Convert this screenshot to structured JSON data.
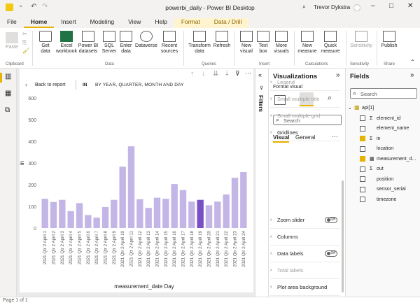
{
  "window": {
    "title": "powerbi_daily - Power BI Desktop",
    "user": "Trevor Dykstra"
  },
  "menu": {
    "items": [
      "File",
      "Home",
      "Insert",
      "Modeling",
      "View",
      "Help",
      "Format",
      "Data / Drill"
    ],
    "active": "Home",
    "contextual": [
      "Format",
      "Data / Drill"
    ]
  },
  "ribbon": {
    "clipboard": {
      "paste": "Paste",
      "group": "Clipboard"
    },
    "data": {
      "buttons": [
        "Get data",
        "Excel workbook",
        "Power BI datasets",
        "SQL Server",
        "Enter data",
        "Dataverse",
        "Recent sources"
      ],
      "group": "Data"
    },
    "queries": {
      "buttons": [
        "Transform data",
        "Refresh"
      ],
      "group": "Queries"
    },
    "insert": {
      "buttons": [
        "New visual",
        "Text box",
        "More visuals"
      ],
      "group": "Insert"
    },
    "calculations": {
      "buttons": [
        "New measure",
        "Quick measure"
      ],
      "group": "Calculations"
    },
    "sensitivity": {
      "buttons": [
        "Sensitivity"
      ],
      "group": "Sensitivity"
    },
    "share": {
      "buttons": [
        "Publish"
      ],
      "group": "Share"
    }
  },
  "visual_header": {
    "back": "Back to report",
    "field": "IN",
    "drill": "BY YEAR, QUARTER, MONTH AND DAY"
  },
  "chart_data": {
    "type": "bar",
    "categories": [
      "2021 Qtr 2 April 1",
      "2021 Qtr 2 April 2",
      "2021 Qtr 2 April 3",
      "2021 Qtr 2 April 4",
      "2021 Qtr 2 April 5",
      "2021 Qtr 2 April 6",
      "2021 Qtr 2 April 7",
      "2021 Qtr 2 April 8",
      "2021 Qtr 2 April 9",
      "2021 Qtr 2 April 10",
      "2021 Qtr 2 April 11",
      "2021 Qtr 2 April 12",
      "2021 Qtr 2 April 13",
      "2021 Qtr 2 April 14",
      "2021 Qtr 2 April 15",
      "2021 Qtr 2 April 16",
      "2021 Qtr 2 April 17",
      "2021 Qtr 2 April 18",
      "2021 Qtr 2 April 19",
      "2021 Qtr 2 April 20",
      "2021 Qtr 2 April 21",
      "2021 Qtr 2 April 22",
      "2021 Qtr 2 April 23",
      "2021 Qtr 2 April 24"
    ],
    "values": [
      135,
      120,
      130,
      78,
      115,
      60,
      48,
      97,
      130,
      283,
      377,
      133,
      93,
      140,
      135,
      203,
      175,
      122,
      130,
      105,
      122,
      155,
      232,
      258
    ],
    "highlight_index": 18,
    "xlabel": "measurement_date Day",
    "ylabel": "in",
    "ylim": [
      0,
      600
    ],
    "yticks": [
      0,
      100,
      200,
      300,
      400,
      500,
      600
    ],
    "colors": {
      "bar": "#c3b6e6",
      "highlight": "#7a4fc4"
    }
  },
  "viz_pane": {
    "title": "Visualizations",
    "subtitle": "Format visual",
    "search": "Search",
    "tabs": [
      "Visual",
      "General"
    ],
    "sections": [
      {
        "label": "Legend",
        "disabled": true
      },
      {
        "label": "Small multiple title",
        "disabled": true
      },
      {
        "label": "Small multiple grid",
        "disabled": true
      },
      {
        "label": "Gridlines",
        "disabled": false
      },
      {
        "label": "Zoom slider",
        "disabled": false,
        "toggle": "Off"
      },
      {
        "label": "Columns",
        "disabled": false
      },
      {
        "label": "Data labels",
        "disabled": false,
        "toggle": "Off"
      },
      {
        "label": "Total labels",
        "disabled": true
      },
      {
        "label": "Plot area background",
        "disabled": false
      }
    ]
  },
  "filters_label": "Filters",
  "fields_pane": {
    "title": "Fields",
    "search": "Search",
    "table": "api[1]",
    "fields": [
      {
        "name": "element_id",
        "sigma": true,
        "checked": false
      },
      {
        "name": "element_name",
        "sigma": false,
        "checked": false
      },
      {
        "name": "in",
        "sigma": true,
        "checked": true
      },
      {
        "name": "location",
        "sigma": false,
        "checked": false
      },
      {
        "name": "measurement_d...",
        "sigma": false,
        "checked": true,
        "hier": true
      },
      {
        "name": "out",
        "sigma": true,
        "checked": false
      },
      {
        "name": "position",
        "sigma": false,
        "checked": false
      },
      {
        "name": "sensor_serial",
        "sigma": false,
        "checked": false
      },
      {
        "name": "timezone",
        "sigma": false,
        "checked": false
      }
    ]
  },
  "status": {
    "page": "Page 1 of 1"
  }
}
